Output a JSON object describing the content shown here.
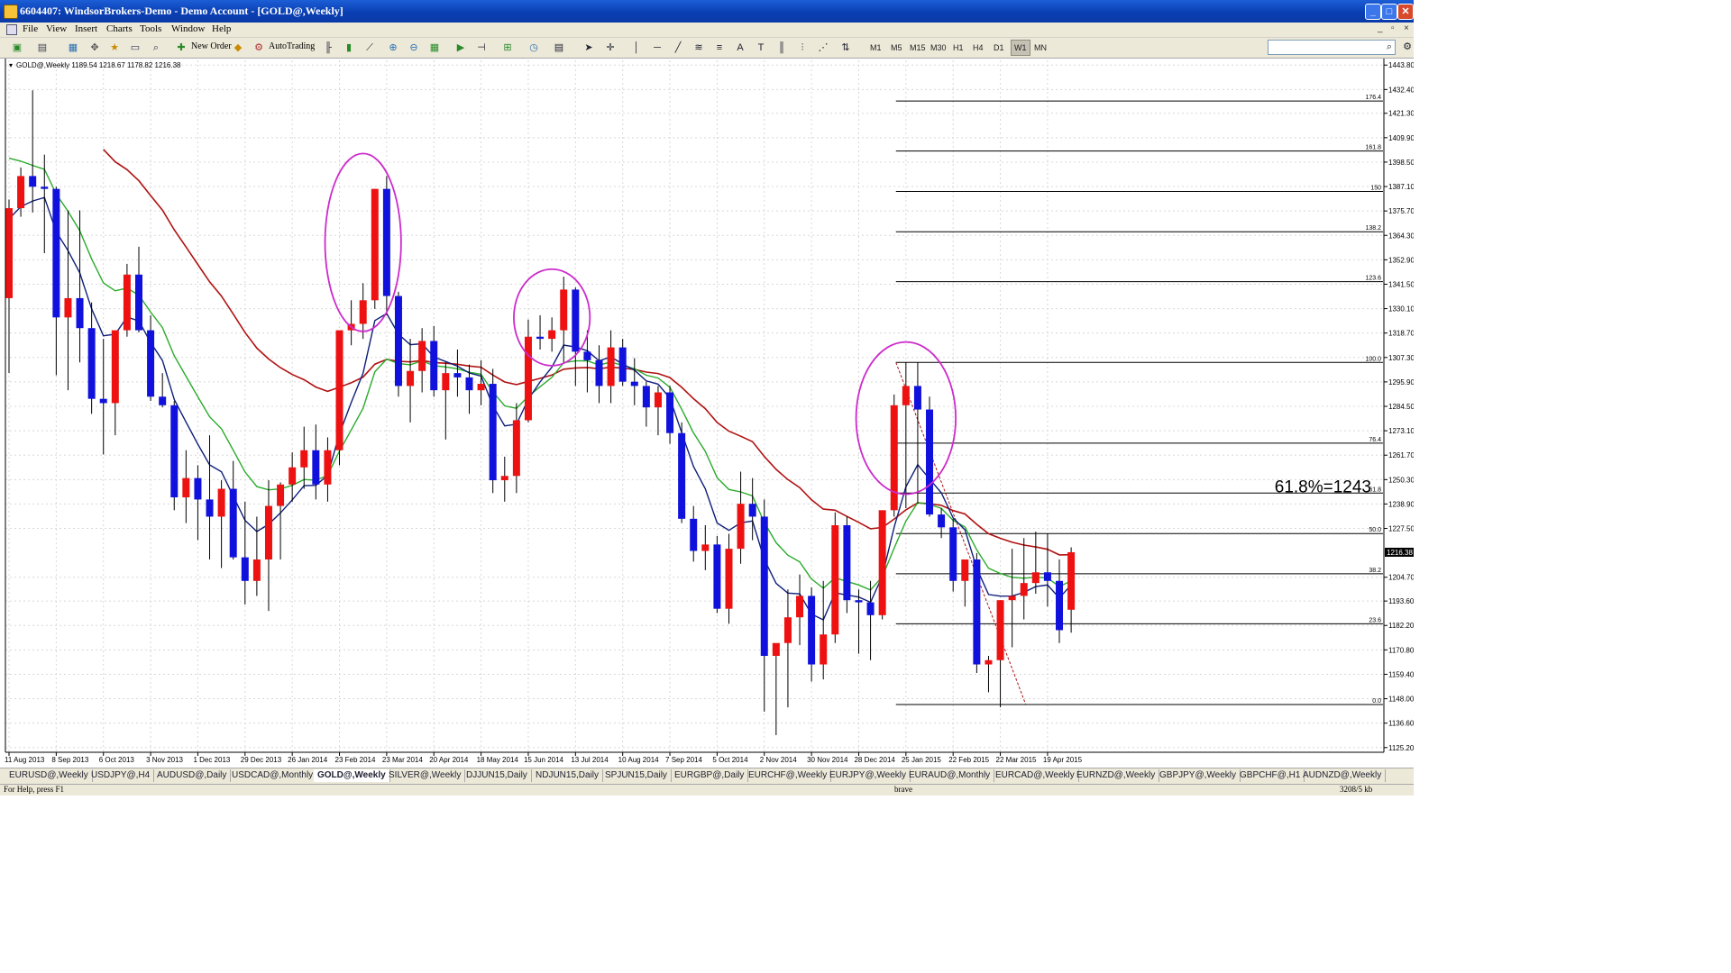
{
  "window": {
    "title": "6604407: WindsorBrokers-Demo - Demo Account - [GOLD@,Weekly]",
    "minimize_label": "_",
    "maximize_label": "□",
    "close_label": "✕"
  },
  "menu": {
    "items": [
      "File",
      "View",
      "Insert",
      "Charts",
      "Tools",
      "Window",
      "Help"
    ],
    "mdi_buttons": [
      "_",
      "▫",
      "×"
    ]
  },
  "toolbar": {
    "new_order_label": "New Order",
    "autotrading_label": "AutoTrading",
    "timeframes": [
      "M1",
      "M5",
      "M15",
      "M30",
      "H1",
      "H4",
      "D1",
      "W1",
      "MN"
    ],
    "active_timeframe": "W1"
  },
  "chart_info": {
    "header": "GOLD@,Weekly  1189.54 1218.67 1178.82 1216.38",
    "current_price": "1216.38",
    "annotation": "61.8%=1243"
  },
  "chart_data": {
    "type": "candlestick",
    "symbol": "GOLD@",
    "timeframe": "Weekly",
    "y_ticks": [
      1443.8,
      1432.4,
      1421.3,
      1409.9,
      1398.5,
      1387.1,
      1375.7,
      1364.3,
      1352.9,
      1341.5,
      1330.1,
      1318.7,
      1307.3,
      1295.9,
      1284.5,
      1273.1,
      1261.7,
      1250.3,
      1238.9,
      1227.5,
      1216.38,
      1204.7,
      1193.6,
      1182.2,
      1170.8,
      1159.4,
      1148.0,
      1136.6,
      1125.2
    ],
    "ylim": [
      1123,
      1446
    ],
    "x_ticks": [
      "11 Aug 2013",
      "8 Sep 2013",
      "6 Oct 2013",
      "3 Nov 2013",
      "1 Dec 2013",
      "29 Dec 2013",
      "26 Jan 2014",
      "23 Feb 2014",
      "23 Mar 2014",
      "20 Apr 2014",
      "18 May 2014",
      "15 Jun 2014",
      "13 Jul 2014",
      "10 Aug 2014",
      "7 Sep 2014",
      "5 Oct 2014",
      "2 Nov 2014",
      "30 Nov 2014",
      "28 Dec 2014",
      "25 Jan 2015",
      "22 Feb 2015",
      "22 Mar 2015",
      "19 Apr 2015"
    ],
    "bar_count": 91,
    "candles_ohlc": [
      [
        1335,
        1381,
        1300,
        1377
      ],
      [
        1377,
        1396,
        1373,
        1392
      ],
      [
        1392,
        1432,
        1375,
        1387
      ],
      [
        1387,
        1402,
        1356,
        1386
      ],
      [
        1386,
        1387,
        1299,
        1326
      ],
      [
        1326,
        1376,
        1292,
        1335
      ],
      [
        1335,
        1376,
        1305,
        1321
      ],
      [
        1321,
        1333,
        1281,
        1288
      ],
      [
        1288,
        1316,
        1262,
        1286
      ],
      [
        1286,
        1319,
        1271,
        1320
      ],
      [
        1320,
        1351,
        1317,
        1346
      ],
      [
        1346,
        1359,
        1319,
        1320
      ],
      [
        1320,
        1327,
        1287,
        1289
      ],
      [
        1289,
        1300,
        1284,
        1285
      ],
      [
        1285,
        1287,
        1236,
        1242
      ],
      [
        1242,
        1264,
        1230,
        1251
      ],
      [
        1251,
        1257,
        1222,
        1241
      ],
      [
        1241,
        1271,
        1213,
        1233
      ],
      [
        1233,
        1250,
        1209,
        1246
      ],
      [
        1246,
        1259,
        1213,
        1214
      ],
      [
        1214,
        1240,
        1192,
        1203
      ],
      [
        1203,
        1233,
        1196,
        1213
      ],
      [
        1213,
        1250,
        1189,
        1238
      ],
      [
        1238,
        1249,
        1213,
        1248
      ],
      [
        1248,
        1263,
        1240,
        1256
      ],
      [
        1256,
        1275,
        1246,
        1264
      ],
      [
        1264,
        1276,
        1241,
        1248
      ],
      [
        1248,
        1270,
        1240,
        1264
      ],
      [
        1264,
        1319,
        1257,
        1320
      ],
      [
        1320,
        1334,
        1313,
        1323
      ],
      [
        1323,
        1342,
        1316,
        1334
      ],
      [
        1334,
        1386,
        1330,
        1386
      ],
      [
        1386,
        1392,
        1327,
        1336
      ],
      [
        1336,
        1338,
        1289,
        1294
      ],
      [
        1294,
        1316,
        1277,
        1301
      ],
      [
        1301,
        1321,
        1291,
        1315
      ],
      [
        1315,
        1322,
        1289,
        1292
      ],
      [
        1292,
        1305,
        1269,
        1300
      ],
      [
        1300,
        1311,
        1289,
        1298
      ],
      [
        1298,
        1304,
        1281,
        1292
      ],
      [
        1292,
        1306,
        1285,
        1295
      ],
      [
        1295,
        1302,
        1244,
        1250
      ],
      [
        1250,
        1261,
        1240,
        1252
      ],
      [
        1252,
        1286,
        1244,
        1278
      ],
      [
        1278,
        1325,
        1277,
        1317
      ],
      [
        1317,
        1327,
        1311,
        1316
      ],
      [
        1316,
        1326,
        1310,
        1320
      ],
      [
        1320,
        1345,
        1305,
        1339
      ],
      [
        1339,
        1340,
        1294,
        1310
      ],
      [
        1310,
        1320,
        1291,
        1306
      ],
      [
        1306,
        1313,
        1286,
        1294
      ],
      [
        1294,
        1320,
        1286,
        1312
      ],
      [
        1312,
        1316,
        1294,
        1296
      ],
      [
        1296,
        1307,
        1285,
        1294
      ],
      [
        1294,
        1296,
        1275,
        1284
      ],
      [
        1284,
        1294,
        1271,
        1291
      ],
      [
        1291,
        1294,
        1267,
        1272
      ],
      [
        1272,
        1277,
        1230,
        1232
      ],
      [
        1232,
        1238,
        1212,
        1217
      ],
      [
        1217,
        1229,
        1208,
        1220
      ],
      [
        1220,
        1224,
        1188,
        1190
      ],
      [
        1190,
        1225,
        1183,
        1218
      ],
      [
        1218,
        1254,
        1211,
        1239
      ],
      [
        1239,
        1251,
        1222,
        1233
      ],
      [
        1233,
        1241,
        1142,
        1168
      ],
      [
        1168,
        1171,
        1131,
        1174
      ],
      [
        1174,
        1199,
        1144,
        1186
      ],
      [
        1186,
        1206,
        1173,
        1196
      ],
      [
        1196,
        1200,
        1156,
        1164
      ],
      [
        1164,
        1203,
        1157,
        1178
      ],
      [
        1178,
        1235,
        1174,
        1229
      ],
      [
        1229,
        1233,
        1188,
        1194
      ],
      [
        1194,
        1199,
        1169,
        1193
      ],
      [
        1193,
        1203,
        1166,
        1187
      ],
      [
        1187,
        1233,
        1185,
        1236
      ],
      [
        1236,
        1290,
        1233,
        1285
      ],
      [
        1285,
        1305,
        1237,
        1294
      ],
      [
        1294,
        1305,
        1239,
        1283
      ],
      [
        1283,
        1289,
        1233,
        1234
      ],
      [
        1234,
        1237,
        1223,
        1228
      ],
      [
        1228,
        1232,
        1198,
        1203
      ],
      [
        1203,
        1213,
        1191,
        1213
      ],
      [
        1213,
        1216,
        1160,
        1164
      ],
      [
        1164,
        1168,
        1151,
        1166
      ],
      [
        1166,
        1194,
        1144,
        1194
      ],
      [
        1194,
        1218,
        1172,
        1196
      ],
      [
        1196,
        1223,
        1185,
        1202
      ],
      [
        1202,
        1226,
        1197,
        1207
      ],
      [
        1207,
        1225,
        1191,
        1203
      ],
      [
        1203,
        1213,
        1174,
        1180
      ],
      [
        1189.54,
        1218.67,
        1178.82,
        1216.38
      ]
    ],
    "moving_averages": [
      {
        "color": "#b01212",
        "role": "slow"
      },
      {
        "color": "#2aab2a",
        "role": "medium"
      },
      {
        "color": "#0e1f7a",
        "role": "fast"
      }
    ],
    "fibonacci_levels": [
      {
        "label": "176.4",
        "price": 1427.0
      },
      {
        "label": "161.8",
        "price": 1403.7
      },
      {
        "label": "150",
        "price": 1384.8
      },
      {
        "label": "138.2",
        "price": 1366.0
      },
      {
        "label": "123.6",
        "price": 1342.7
      },
      {
        "label": "100.0",
        "price": 1305.0
      },
      {
        "label": "76.4",
        "price": 1267.3
      },
      {
        "label": "61.8",
        "price": 1244.0
      },
      {
        "label": "50.0",
        "price": 1225.1
      },
      {
        "label": "38.2",
        "price": 1206.3
      },
      {
        "label": "23.6",
        "price": 1183.0
      },
      {
        "label": "0.0",
        "price": 1145.3
      }
    ],
    "bull_color": "#ee1111",
    "bear_color": "#1111dd",
    "grid": true
  },
  "tabs": [
    "EURUSD@,Weekly",
    "USDJPY@,H4",
    "AUDUSD@,Daily",
    "USDCAD@,Monthly",
    "GOLD@,Weekly",
    "SILVER@,Weekly",
    "DJJUN15,Daily",
    "NDJUN15,Daily",
    "SPJUN15,Daily",
    "EURGBP@,Daily",
    "EURCHF@,Weekly",
    "EURJPY@,Weekly",
    "EURAUD@,Monthly",
    "EURCAD@,Weekly",
    "EURNZD@,Weekly",
    "GBPJPY@,Weekly",
    "GBPCHF@,H1",
    "AUDNZD@,Weekly"
  ],
  "status": {
    "help": "For Help, press F1",
    "profile": "brave",
    "traffic": "3208/5 kb"
  }
}
